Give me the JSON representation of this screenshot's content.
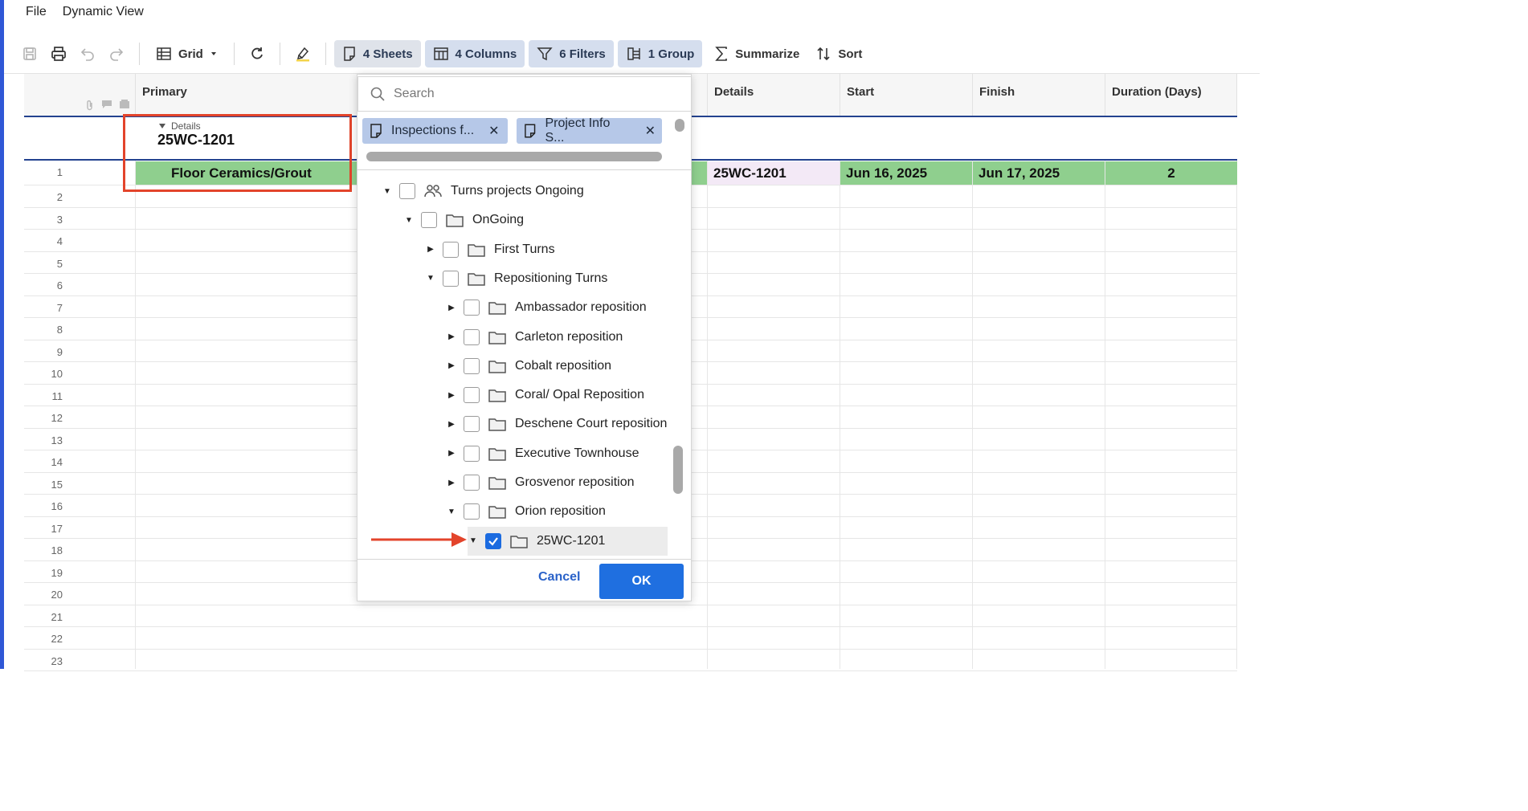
{
  "menu": {
    "file": "File",
    "dynamic_view": "Dynamic View"
  },
  "toolbar": {
    "view_label": "Grid",
    "sheets_label": "4 Sheets",
    "columns_label": "4 Columns",
    "filters_label": "6 Filters",
    "group_label": "1 Group",
    "summarize_label": "Summarize",
    "sort_label": "Sort"
  },
  "grid": {
    "headers": {
      "primary": "Primary",
      "details": "Details",
      "start": "Start",
      "finish": "Finish",
      "duration": "Duration (Days)"
    },
    "group": {
      "field": "Details",
      "value": "25WC-1201"
    },
    "row1": {
      "primary": "Floor Ceramics/Grout",
      "details": "25WC-1201",
      "start": "Jun 16, 2025",
      "finish": "Jun 17, 2025",
      "duration": "2"
    },
    "row_numbers": [
      "1",
      "2",
      "3",
      "4",
      "5",
      "6",
      "7",
      "8",
      "9",
      "10",
      "11",
      "12",
      "13",
      "14",
      "15",
      "16",
      "17",
      "18",
      "19",
      "20",
      "21",
      "22",
      "23"
    ]
  },
  "colors": {
    "row_green": "#8fcf8e",
    "details_cell": "#f3e9f6",
    "accent": "#1f6fe0",
    "highlight": "#e3442b"
  },
  "dialog": {
    "search_placeholder": "Search",
    "chips": [
      "Inspections f...",
      "Project Info S..."
    ],
    "tree": [
      {
        "label": "Turns projects Ongoing",
        "icon": "people-icon",
        "expanded": true
      },
      {
        "label": "OnGoing",
        "icon": "folder-icon",
        "expanded": true
      },
      {
        "label": "First Turns",
        "icon": "folder-icon",
        "expanded": false
      },
      {
        "label": "Repositioning Turns",
        "icon": "folder-icon",
        "expanded": true
      },
      {
        "label": "Ambassador reposition",
        "icon": "folder-icon",
        "expanded": false
      },
      {
        "label": "Carleton reposition",
        "icon": "folder-icon",
        "expanded": false
      },
      {
        "label": "Cobalt reposition",
        "icon": "folder-icon",
        "expanded": false
      },
      {
        "label": "Coral/ Opal Reposition",
        "icon": "folder-icon",
        "expanded": false
      },
      {
        "label": "Deschene Court reposition",
        "icon": "folder-icon",
        "expanded": false
      },
      {
        "label": "Executive Townhouse",
        "icon": "folder-icon",
        "expanded": false
      },
      {
        "label": "Grosvenor reposition",
        "icon": "folder-icon",
        "expanded": false
      },
      {
        "label": "Orion reposition",
        "icon": "folder-icon",
        "expanded": true
      },
      {
        "label": "25WC-1201",
        "icon": "folder-icon",
        "expanded": true,
        "checked": true
      }
    ],
    "cancel_label": "Cancel",
    "ok_label": "OK"
  }
}
